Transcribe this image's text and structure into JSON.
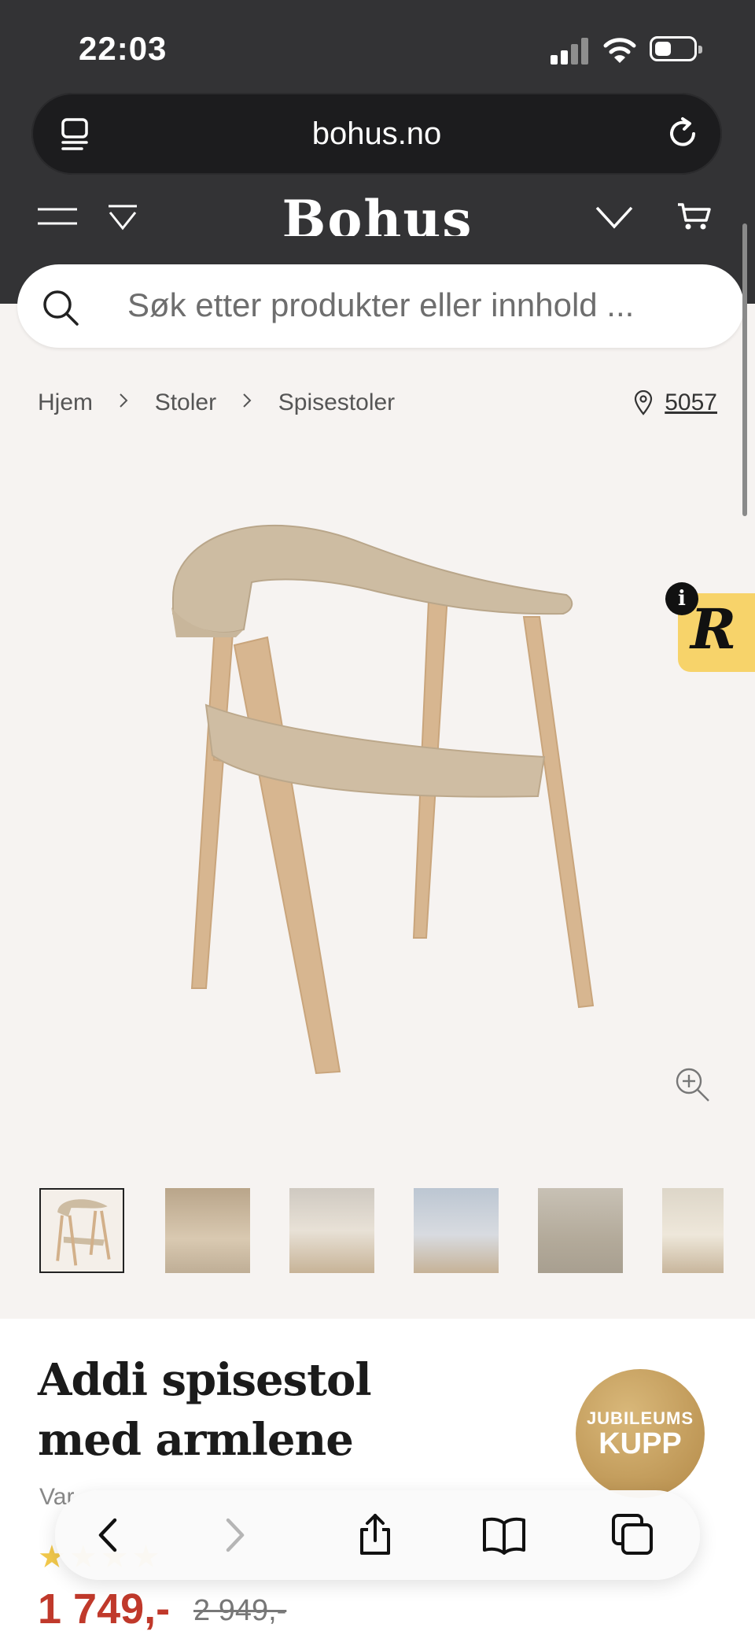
{
  "status_bar": {
    "time": "22:03"
  },
  "browser": {
    "url": "bohus.no"
  },
  "site": {
    "logo": "Bohus"
  },
  "search": {
    "placeholder": "Søk etter produkter eller innhold ..."
  },
  "breadcrumb": {
    "items": [
      "Hjem",
      "Stoler",
      "Spisestoler"
    ],
    "store_number": "5057"
  },
  "product": {
    "title": "Addi spisestol med armlene",
    "variant_label": "Var",
    "price": "1 749,-",
    "old_price": "2 949,-",
    "thumbnails_count": 6
  },
  "badge": {
    "line1": "JUBILEUMS",
    "line2": "KUPP"
  },
  "widget": {
    "letter": "R",
    "info": "i"
  },
  "colors": {
    "header_bg": "#333335",
    "page_bg": "#f6f3f1",
    "price": "#c0392b",
    "badge_gold": "#c49a57"
  },
  "icons": [
    "tabs-icon",
    "reload-icon",
    "menu-icon",
    "dropdown-icon",
    "chevron-down-icon",
    "cart-icon",
    "search-icon",
    "location-pin-icon",
    "zoom-icon",
    "back-icon",
    "forward-icon",
    "share-icon",
    "bookmarks-icon",
    "tabs-overview-icon"
  ]
}
